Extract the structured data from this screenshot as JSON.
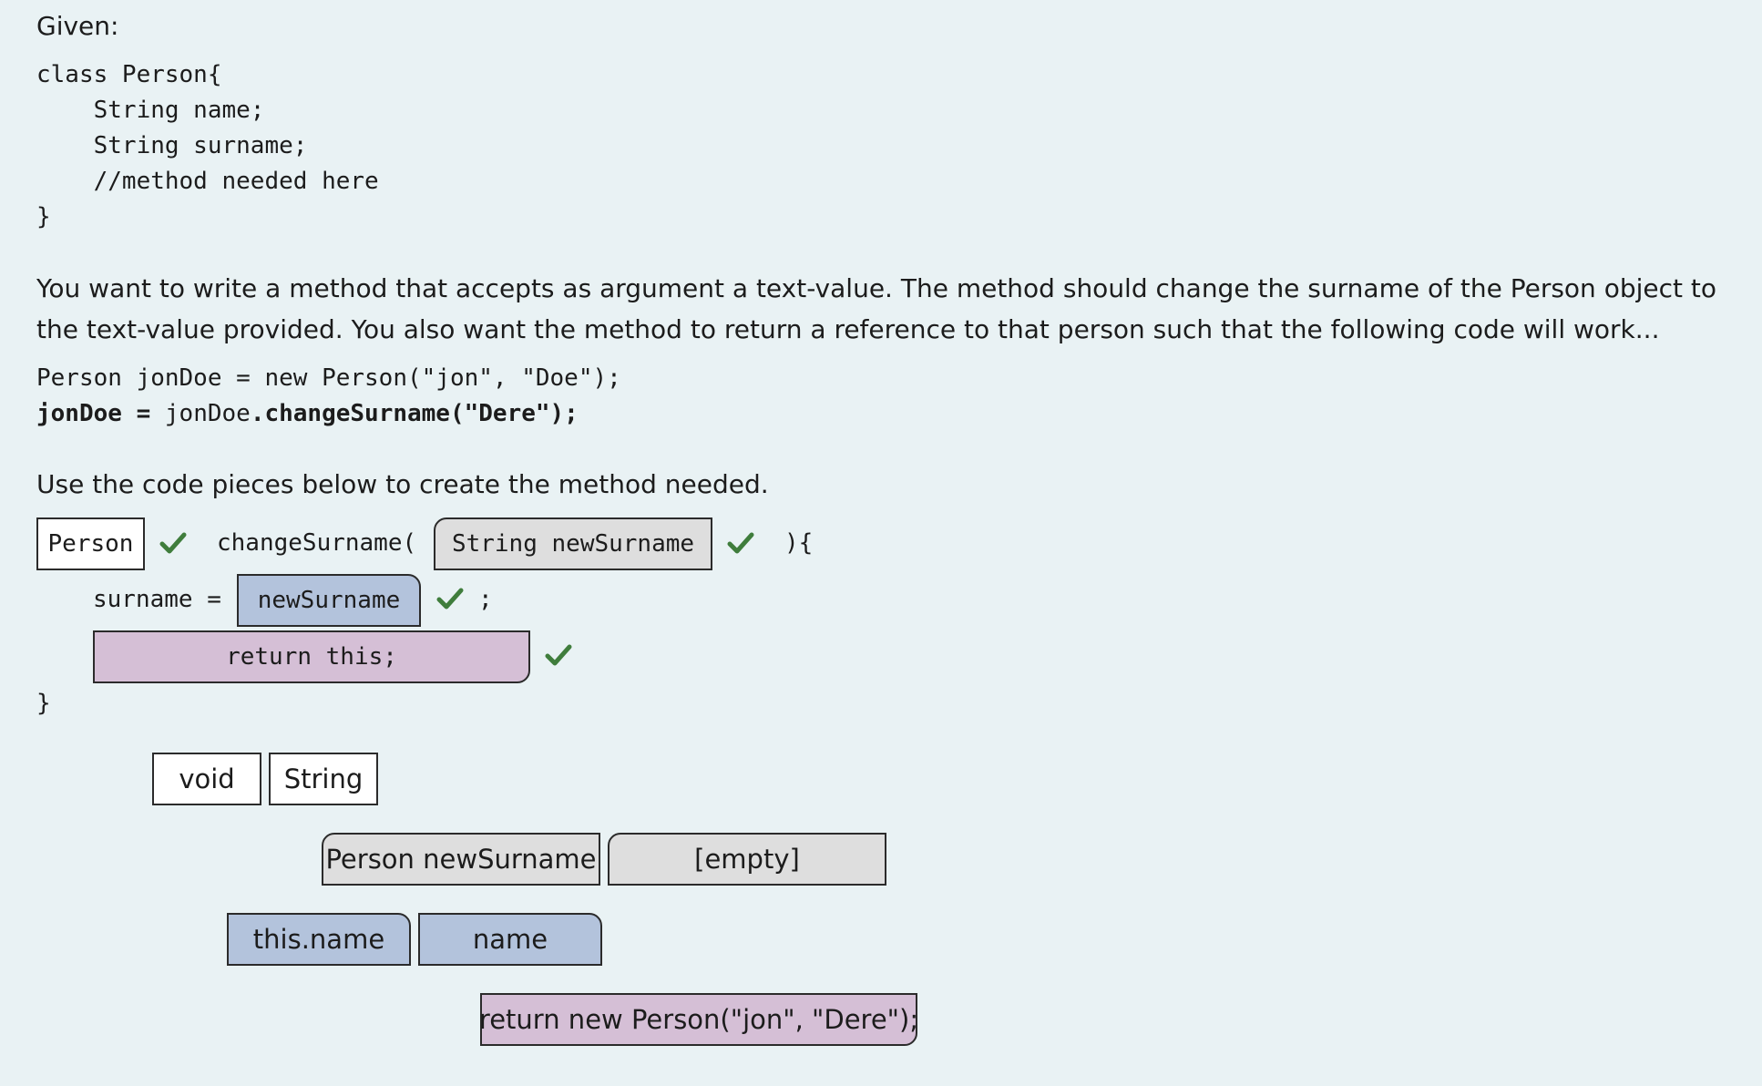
{
  "intro": {
    "given_label": "Given:",
    "class_code": [
      "class Person{",
      "    String name;",
      "    String surname;",
      "    //method needed here",
      "}"
    ],
    "description": "You want to write a method that accepts as argument a text-value. The method should change the surname of the Person object to the text-value provided. You also want the method to return a reference to that person such that the following code will work...",
    "usage_line1": "Person jonDoe = new Person(\"jon\", \"Doe\");",
    "usage_line2": {
      "part1": "jonDoe =",
      "part2": " jonDoe",
      "part3": ".changeSurname(\"Dere\");"
    },
    "instruction": "Use the code pieces below to create the method needed."
  },
  "method_template": {
    "signature_middle": "changeSurname(",
    "signature_end": "){",
    "assign_prefix": "surname =",
    "assign_suffix": ";",
    "closing_brace": "}"
  },
  "placed_pieces": {
    "return_type": "Person",
    "parameter": "String newSurname",
    "assign_value": "newSurname",
    "return_statement": "return this;"
  },
  "piece_bank": {
    "return_types": [
      "void",
      "String"
    ],
    "parameters": [
      "Person newSurname",
      "[empty]"
    ],
    "values": [
      "this.name",
      "name"
    ],
    "returns": [
      "return new Person(\"jon\", \"Dere\");"
    ]
  },
  "colors": {
    "background": "#e9f2f4",
    "check_green": "#3f7d3c",
    "tile_white": "#ffffff",
    "tile_gray": "#dedede",
    "tile_blue": "#b3c3dc",
    "tile_pink": "#d5bfd6"
  },
  "icons": {
    "correct": "check-icon"
  }
}
